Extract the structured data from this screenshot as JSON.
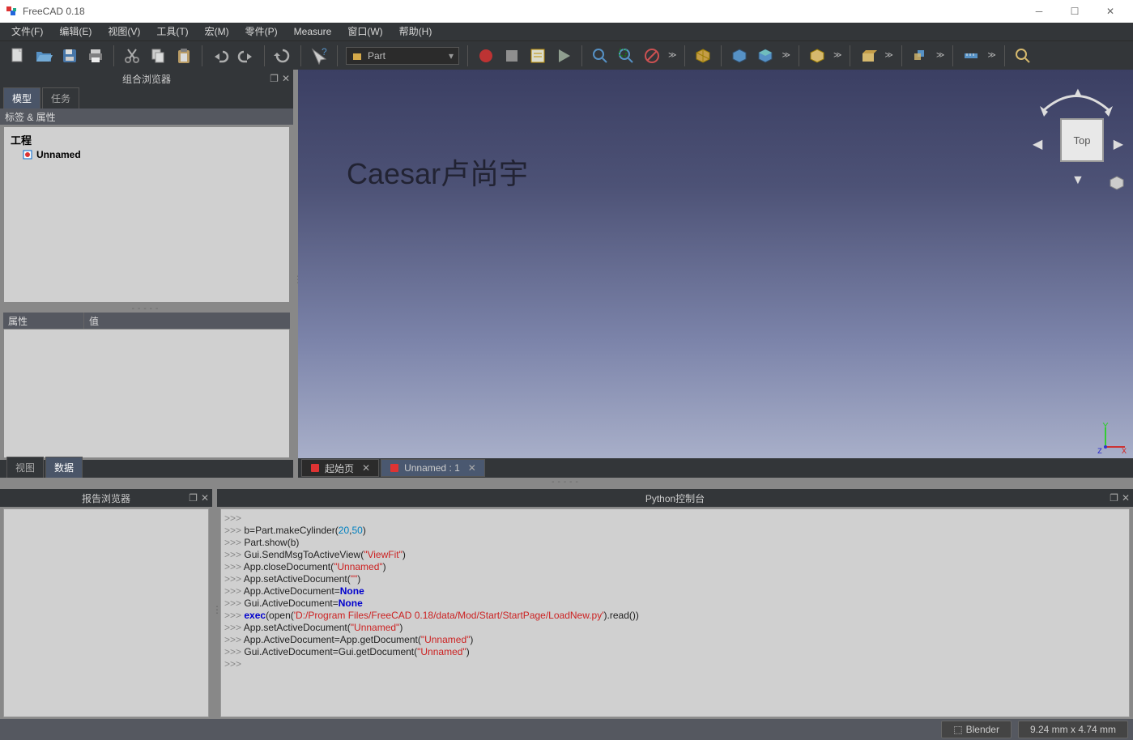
{
  "title": "FreeCAD 0.18",
  "menu": [
    "文件(F)",
    "编辑(E)",
    "视图(V)",
    "工具(T)",
    "宏(M)",
    "零件(P)",
    "Measure",
    "窗口(W)",
    "帮助(H)"
  ],
  "workbench": "Part",
  "panels": {
    "combo": "组合浏览器",
    "tabs": [
      "模型",
      "任务"
    ],
    "labelattr": "标签 & 属性",
    "project": "工程",
    "docname": "Unnamed",
    "prop": "属性",
    "val": "值",
    "view": "视图",
    "data": "数据",
    "report": "报告浏览器",
    "console": "Python控制台"
  },
  "watermark": "Caesar卢尚宇",
  "cubeface": "Top",
  "doctabs": [
    {
      "label": "起始页",
      "active": false
    },
    {
      "label": "Unnamed : 1",
      "active": true
    }
  ],
  "console_lines": [
    {
      "t": [
        {
          "c": "prompt",
          "s": ">>> "
        }
      ]
    },
    {
      "t": [
        {
          "c": "prompt",
          "s": ">>> "
        },
        {
          "c": "",
          "s": "b"
        },
        {
          "c": "",
          "s": "="
        },
        {
          "c": "",
          "s": "Part.makeCylinder("
        },
        {
          "c": "num",
          "s": "20"
        },
        {
          "c": "",
          "s": ","
        },
        {
          "c": "num",
          "s": "50"
        },
        {
          "c": "",
          "s": ")"
        }
      ]
    },
    {
      "t": [
        {
          "c": "prompt",
          "s": ">>> "
        },
        {
          "c": "",
          "s": "Part.show(b)"
        }
      ]
    },
    {
      "t": [
        {
          "c": "prompt",
          "s": ">>> "
        },
        {
          "c": "",
          "s": "Gui.SendMsgToActiveView("
        },
        {
          "c": "str",
          "s": "\"ViewFit\""
        },
        {
          "c": "",
          "s": ")"
        }
      ]
    },
    {
      "t": [
        {
          "c": "prompt",
          "s": ">>> "
        },
        {
          "c": "",
          "s": "App.closeDocument("
        },
        {
          "c": "str",
          "s": "\"Unnamed\""
        },
        {
          "c": "",
          "s": ")"
        }
      ]
    },
    {
      "t": [
        {
          "c": "prompt",
          "s": ">>> "
        },
        {
          "c": "",
          "s": "App.setActiveDocument("
        },
        {
          "c": "str",
          "s": "\"\""
        },
        {
          "c": "",
          "s": ")"
        }
      ]
    },
    {
      "t": [
        {
          "c": "prompt",
          "s": ">>> "
        },
        {
          "c": "",
          "s": "App.ActiveDocument="
        },
        {
          "c": "kw",
          "s": "None"
        }
      ]
    },
    {
      "t": [
        {
          "c": "prompt",
          "s": ">>> "
        },
        {
          "c": "",
          "s": "Gui.ActiveDocument="
        },
        {
          "c": "kw",
          "s": "None"
        }
      ]
    },
    {
      "t": [
        {
          "c": "prompt",
          "s": ">>> "
        },
        {
          "c": "kw",
          "s": "exec"
        },
        {
          "c": "",
          "s": "(open("
        },
        {
          "c": "str",
          "s": "'D:/Program Files/FreeCAD 0.18/data/Mod/Start/StartPage/LoadNew.py'"
        },
        {
          "c": "",
          "s": ").read())"
        }
      ]
    },
    {
      "t": [
        {
          "c": "prompt",
          "s": ">>> "
        },
        {
          "c": "",
          "s": "App.setActiveDocument("
        },
        {
          "c": "str",
          "s": "\"Unnamed\""
        },
        {
          "c": "",
          "s": ")"
        }
      ]
    },
    {
      "t": [
        {
          "c": "prompt",
          "s": ">>> "
        },
        {
          "c": "",
          "s": "App.ActiveDocument=App.getDocument("
        },
        {
          "c": "str",
          "s": "\"Unnamed\""
        },
        {
          "c": "",
          "s": ")"
        }
      ]
    },
    {
      "t": [
        {
          "c": "prompt",
          "s": ">>> "
        },
        {
          "c": "",
          "s": "Gui.ActiveDocument=Gui.getDocument("
        },
        {
          "c": "str",
          "s": "\"Unnamed\""
        },
        {
          "c": "",
          "s": ")"
        }
      ]
    },
    {
      "t": [
        {
          "c": "prompt",
          "s": ">>> "
        }
      ]
    }
  ],
  "status": {
    "nav": "Blender",
    "coords": "9.24 mm x 4.74 mm"
  }
}
